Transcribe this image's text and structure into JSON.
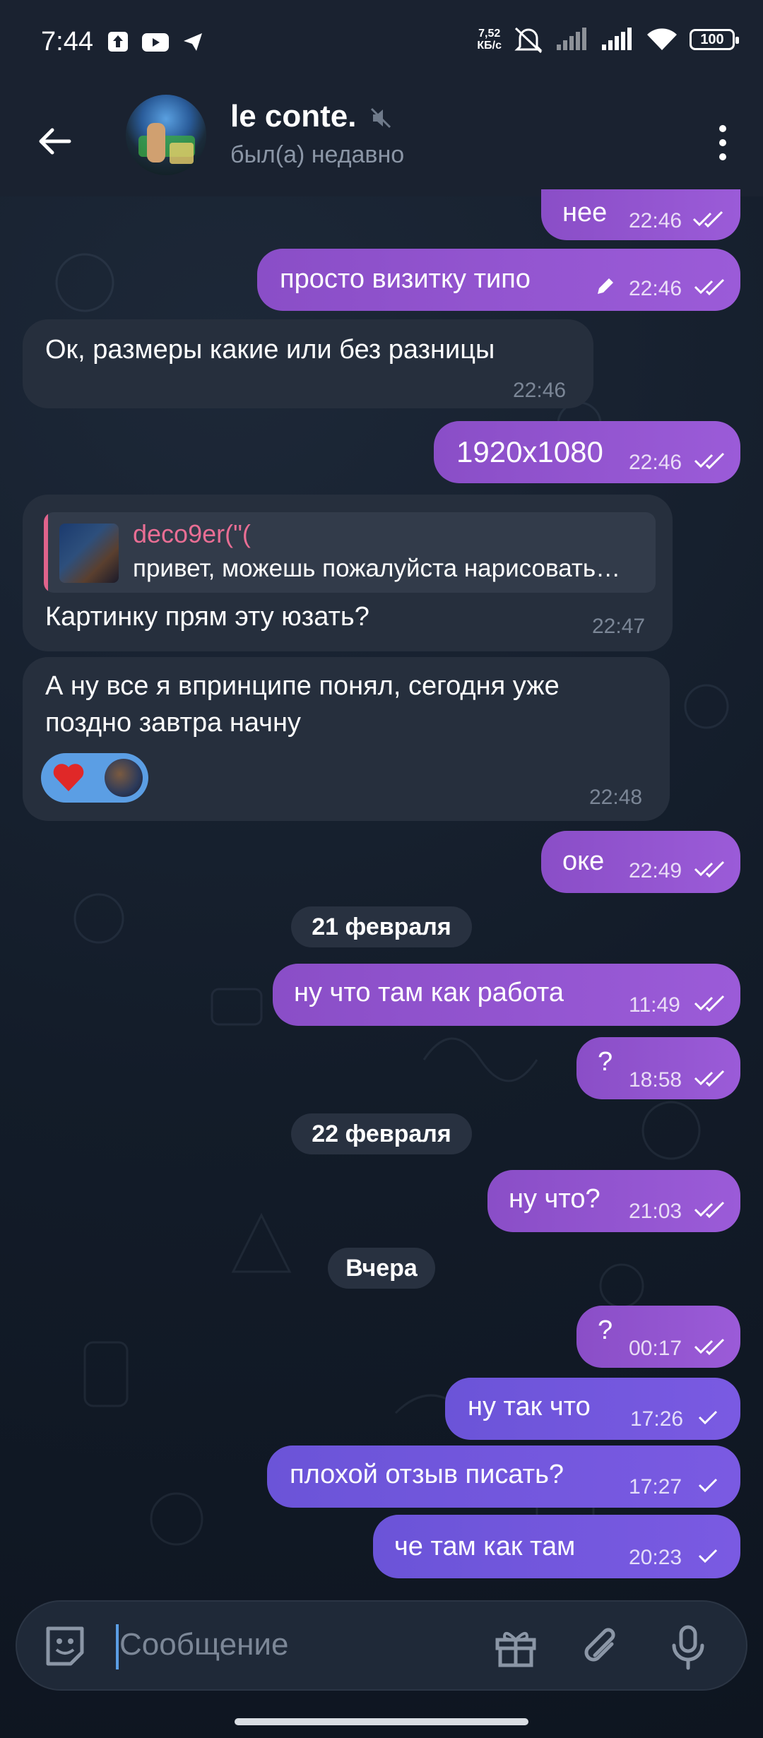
{
  "status_bar": {
    "time": "7:44",
    "net_speed_value": "7,52",
    "net_speed_unit": "КБ/с",
    "battery": "100"
  },
  "header": {
    "contact_name": "le conte.",
    "contact_status": "был(а) недавно"
  },
  "messages": [
    {
      "text": "нее",
      "time": "22:46",
      "dir": "out"
    },
    {
      "text": "просто визитку типо",
      "time": "22:46",
      "dir": "out",
      "edited": true
    },
    {
      "text": "Ок, размеры какие или без разницы",
      "time": "22:46",
      "dir": "in"
    },
    {
      "text": "1920x1080",
      "time": "22:46",
      "dir": "out"
    },
    {
      "reply_name": "deco9er(\"(",
      "reply_text": "привет, можешь пожалуйста нарисовать",
      "text": "Картинку прям эту юзать?",
      "time": "22:47",
      "dir": "in"
    },
    {
      "line1": "А ну все я впринципе понял, сегодня уже",
      "line2": "поздно завтра начну",
      "time": "22:48",
      "dir": "in",
      "reaction": "heart"
    },
    {
      "text": "оке",
      "time": "22:49",
      "dir": "out"
    },
    {
      "text": "ну что там как работа",
      "time": "11:49",
      "dir": "out"
    },
    {
      "text": "?",
      "time": "18:58",
      "dir": "out"
    },
    {
      "text": "ну что?",
      "time": "21:03",
      "dir": "out"
    },
    {
      "text": "?",
      "time": "00:17",
      "dir": "out"
    },
    {
      "text": "ну так что",
      "time": "17:26",
      "dir": "out"
    },
    {
      "text": "плохой отзыв писать?",
      "time": "17:27",
      "dir": "out"
    },
    {
      "text": "че там как там",
      "time": "20:23",
      "dir": "out"
    }
  ],
  "dates": {
    "d1": "21 февраля",
    "d2": "22 февраля",
    "d3": "Вчера"
  },
  "composer": {
    "placeholder": "Сообщение"
  },
  "colors": {
    "outgoing": "#9b5bd8",
    "outgoing_unread": "#7a5ae2",
    "incoming": "#262f3d",
    "reply_name": "#e96e94",
    "reaction": "#5b9ee4"
  },
  "icons": [
    "back-arrow-icon",
    "mute-icon",
    "more-vertical-icon",
    "sticker-icon",
    "gift-icon",
    "attach-icon",
    "mic-icon",
    "double-check-icon",
    "single-check-icon",
    "pencil-icon",
    "heart-icon"
  ]
}
